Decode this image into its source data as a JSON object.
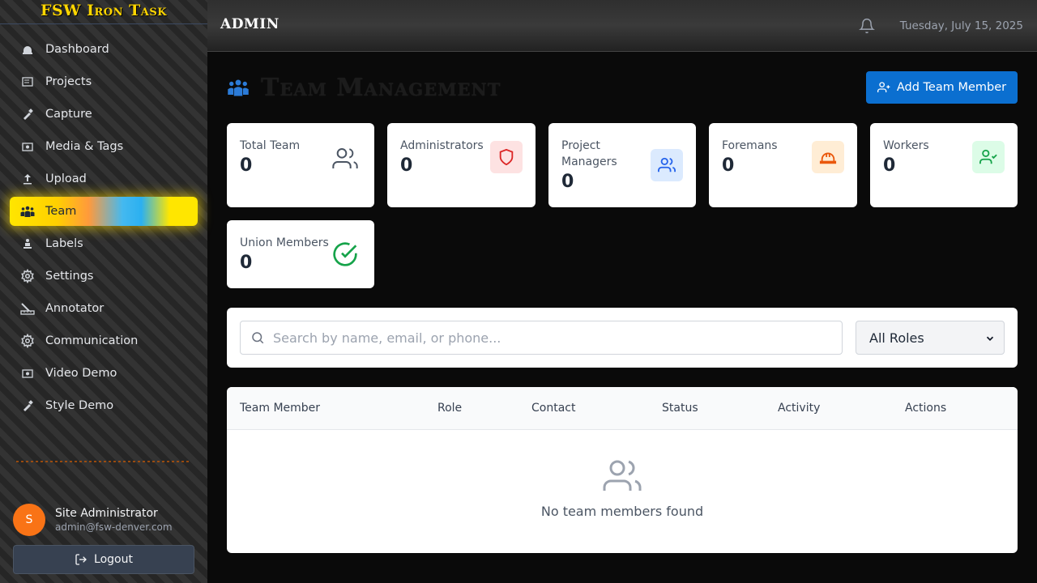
{
  "brand": "FSW Iron Task",
  "sidebar": {
    "items": [
      {
        "label": "Dashboard",
        "icon": "dashboard-icon"
      },
      {
        "label": "Projects",
        "icon": "projects-icon"
      },
      {
        "label": "Capture",
        "icon": "capture-icon"
      },
      {
        "label": "Media & Tags",
        "icon": "media-icon"
      },
      {
        "label": "Upload",
        "icon": "upload-icon"
      },
      {
        "label": "Team",
        "icon": "team-icon",
        "active": true
      },
      {
        "label": "Labels",
        "icon": "labels-icon"
      },
      {
        "label": "Settings",
        "icon": "gear-icon"
      },
      {
        "label": "Annotator",
        "icon": "annotator-icon"
      },
      {
        "label": "Communication",
        "icon": "gear-icon"
      },
      {
        "label": "Video Demo",
        "icon": "video-icon"
      },
      {
        "label": "Style Demo",
        "icon": "style-icon"
      }
    ]
  },
  "user": {
    "initial": "S",
    "name": "Site Administrator",
    "email": "admin@fsw-denver.com",
    "logout_label": "Logout"
  },
  "header": {
    "title": "ADMIN",
    "date": "Tuesday, July 15, 2025"
  },
  "page": {
    "title": "Team Management",
    "add_button_label": "Add Team Member"
  },
  "stats": [
    {
      "label": "Total Team",
      "value": "0",
      "icon": "users-icon"
    },
    {
      "label": "Administrators",
      "value": "0",
      "icon": "shield-icon"
    },
    {
      "label": "Project Managers",
      "value": "0",
      "icon": "users-icon"
    },
    {
      "label": "Foremans",
      "value": "0",
      "icon": "hard-hat-icon"
    },
    {
      "label": "Workers",
      "value": "0",
      "icon": "user-check-icon"
    },
    {
      "label": "Union Members",
      "value": "0",
      "icon": "check-circle-icon"
    }
  ],
  "search": {
    "placeholder": "Search by name, email, or phone...",
    "role_filter": "All Roles"
  },
  "table": {
    "columns": [
      "Team Member",
      "Role",
      "Contact",
      "Status",
      "Activity",
      "Actions"
    ],
    "empty_text": "No team members found"
  },
  "colors": {
    "accent_blue": "#0b6fd0",
    "avatar_orange": "#f97316",
    "brand_yellow": "#ffd600",
    "admin_red": "#dc2626",
    "pm_blue": "#2563eb",
    "foreman_orange": "#ea580c",
    "worker_green": "#16a34a"
  }
}
